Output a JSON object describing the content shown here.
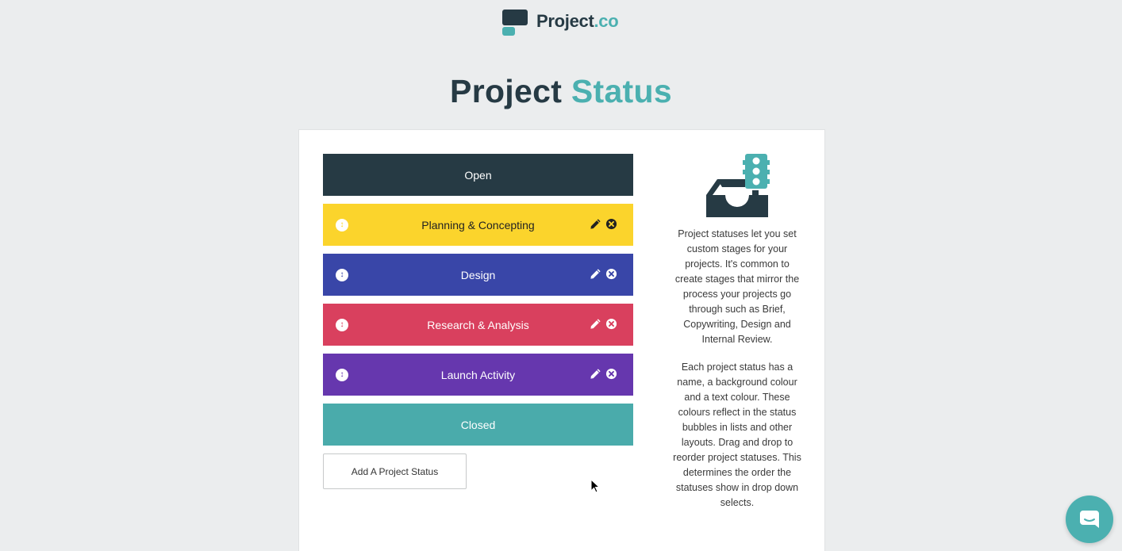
{
  "brand": {
    "name_main": "Project",
    "name_suffix": ".co",
    "primary_color": "#263a44",
    "accent_color": "#4bb0b0"
  },
  "page": {
    "title_main": "Project ",
    "title_accent": "Status"
  },
  "statuses": [
    {
      "label": "Open",
      "bg": "#263a44",
      "fg": "#ffffff",
      "editable": false
    },
    {
      "label": "Planning & Concepting",
      "bg": "#fbd42c",
      "fg": "#222222",
      "editable": true
    },
    {
      "label": "Design",
      "bg": "#3946a8",
      "fg": "#ffffff",
      "editable": true
    },
    {
      "label": "Research & Analysis",
      "bg": "#d9405e",
      "fg": "#ffffff",
      "editable": true
    },
    {
      "label": "Launch Activity",
      "bg": "#6637ae",
      "fg": "#ffffff",
      "editable": true
    },
    {
      "label": "Closed",
      "bg": "#4aabab",
      "fg": "#ffffff",
      "editable": false
    }
  ],
  "add_button": {
    "label": "Add A Project Status"
  },
  "info": {
    "illustration_icon": "inbox-traffic-light-icon",
    "paragraph_1": "Project statuses let you set custom stages for your projects. It's common to create stages that mirror the process your projects go through such as Brief, Copywriting, Design and Internal Review.",
    "paragraph_2": "Each project status has a name, a background colour and a text colour. These colours reflect in the status bubbles in lists and other layouts. Drag and drop to reorder project statuses. This determines the order the statuses show in drop down selects."
  },
  "chat": {
    "icon": "chat-bubble-icon"
  }
}
